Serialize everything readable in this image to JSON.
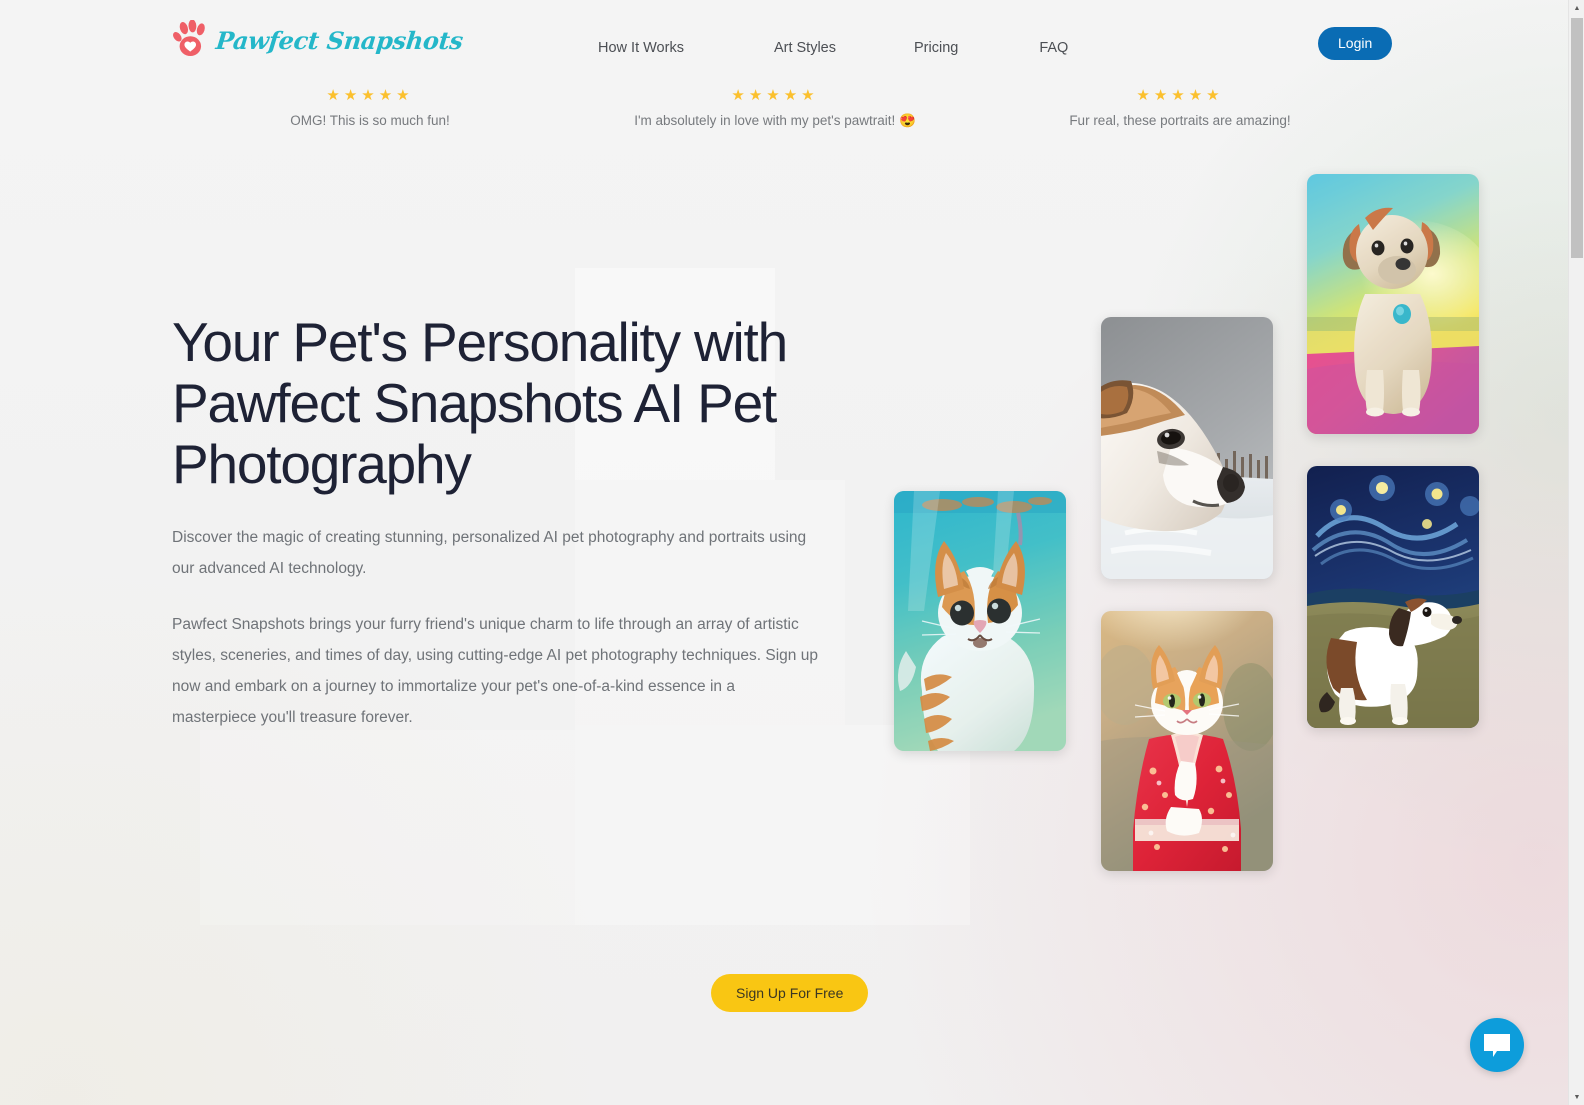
{
  "brand": {
    "name": "Pawfect Snapshots",
    "logo_icon": "paw-heart-icon",
    "logo_color": "#24b7c9",
    "paw_color": "#ef5f67"
  },
  "header": {
    "nav": [
      {
        "label": "How It Works"
      },
      {
        "label": "Art Styles"
      },
      {
        "label": "Pricing"
      },
      {
        "label": "FAQ"
      }
    ],
    "login_label": "Login",
    "login_color": "#0a6cb4"
  },
  "testimonials": [
    {
      "stars": "★★★★★",
      "text": "OMG! This is so much fun!"
    },
    {
      "stars": "★★★★★",
      "text": "I'm absolutely in love with my pet's pawtrait! 😍"
    },
    {
      "stars": "★★★★★",
      "text": "Fur real, these portraits are amazing!"
    }
  ],
  "star_color": "#fbc02d",
  "hero": {
    "title": "Your Pet's Personality with Pawfect Snapshots AI Pet Photography",
    "paragraph1": "Discover the magic of creating stunning, personalized AI pet photography and portraits using our advanced AI technology.",
    "paragraph2": "Pawfect Snapshots brings your furry friend's unique charm to life through an array of artistic styles, sceneries, and times of day, using cutting-edge AI pet photography techniques. Sign up now and embark on a journey to immortalize your pet's one-of-a-kind essence in a masterpiece you'll treasure forever.",
    "cta_label": "Sign Up For Free",
    "cta_color": "#f9c613"
  },
  "gallery": [
    {
      "name": "dog-rainbow-sunset-portrait",
      "alt": "Tan dog with blue tag sitting on pink blanket against rainbow sunset"
    },
    {
      "name": "dog-starry-night-portrait",
      "alt": "Beagle on grass in front of Van Gogh Starry Night sky"
    },
    {
      "name": "dog-snow-portrait",
      "alt": "Chihuahua profile in snowy landscape with grey sky"
    },
    {
      "name": "cat-kimono-portrait",
      "alt": "Ginger and white cat wearing a red floral kimono"
    },
    {
      "name": "cat-underwater-portrait",
      "alt": "Ginger and white cat swimming underwater in turquoise water"
    }
  ],
  "chat": {
    "icon": "chat-bubble-icon",
    "color": "#0d9ddb"
  },
  "scrollbar": {
    "up_arrow": "▲",
    "down_arrow": "▼"
  }
}
